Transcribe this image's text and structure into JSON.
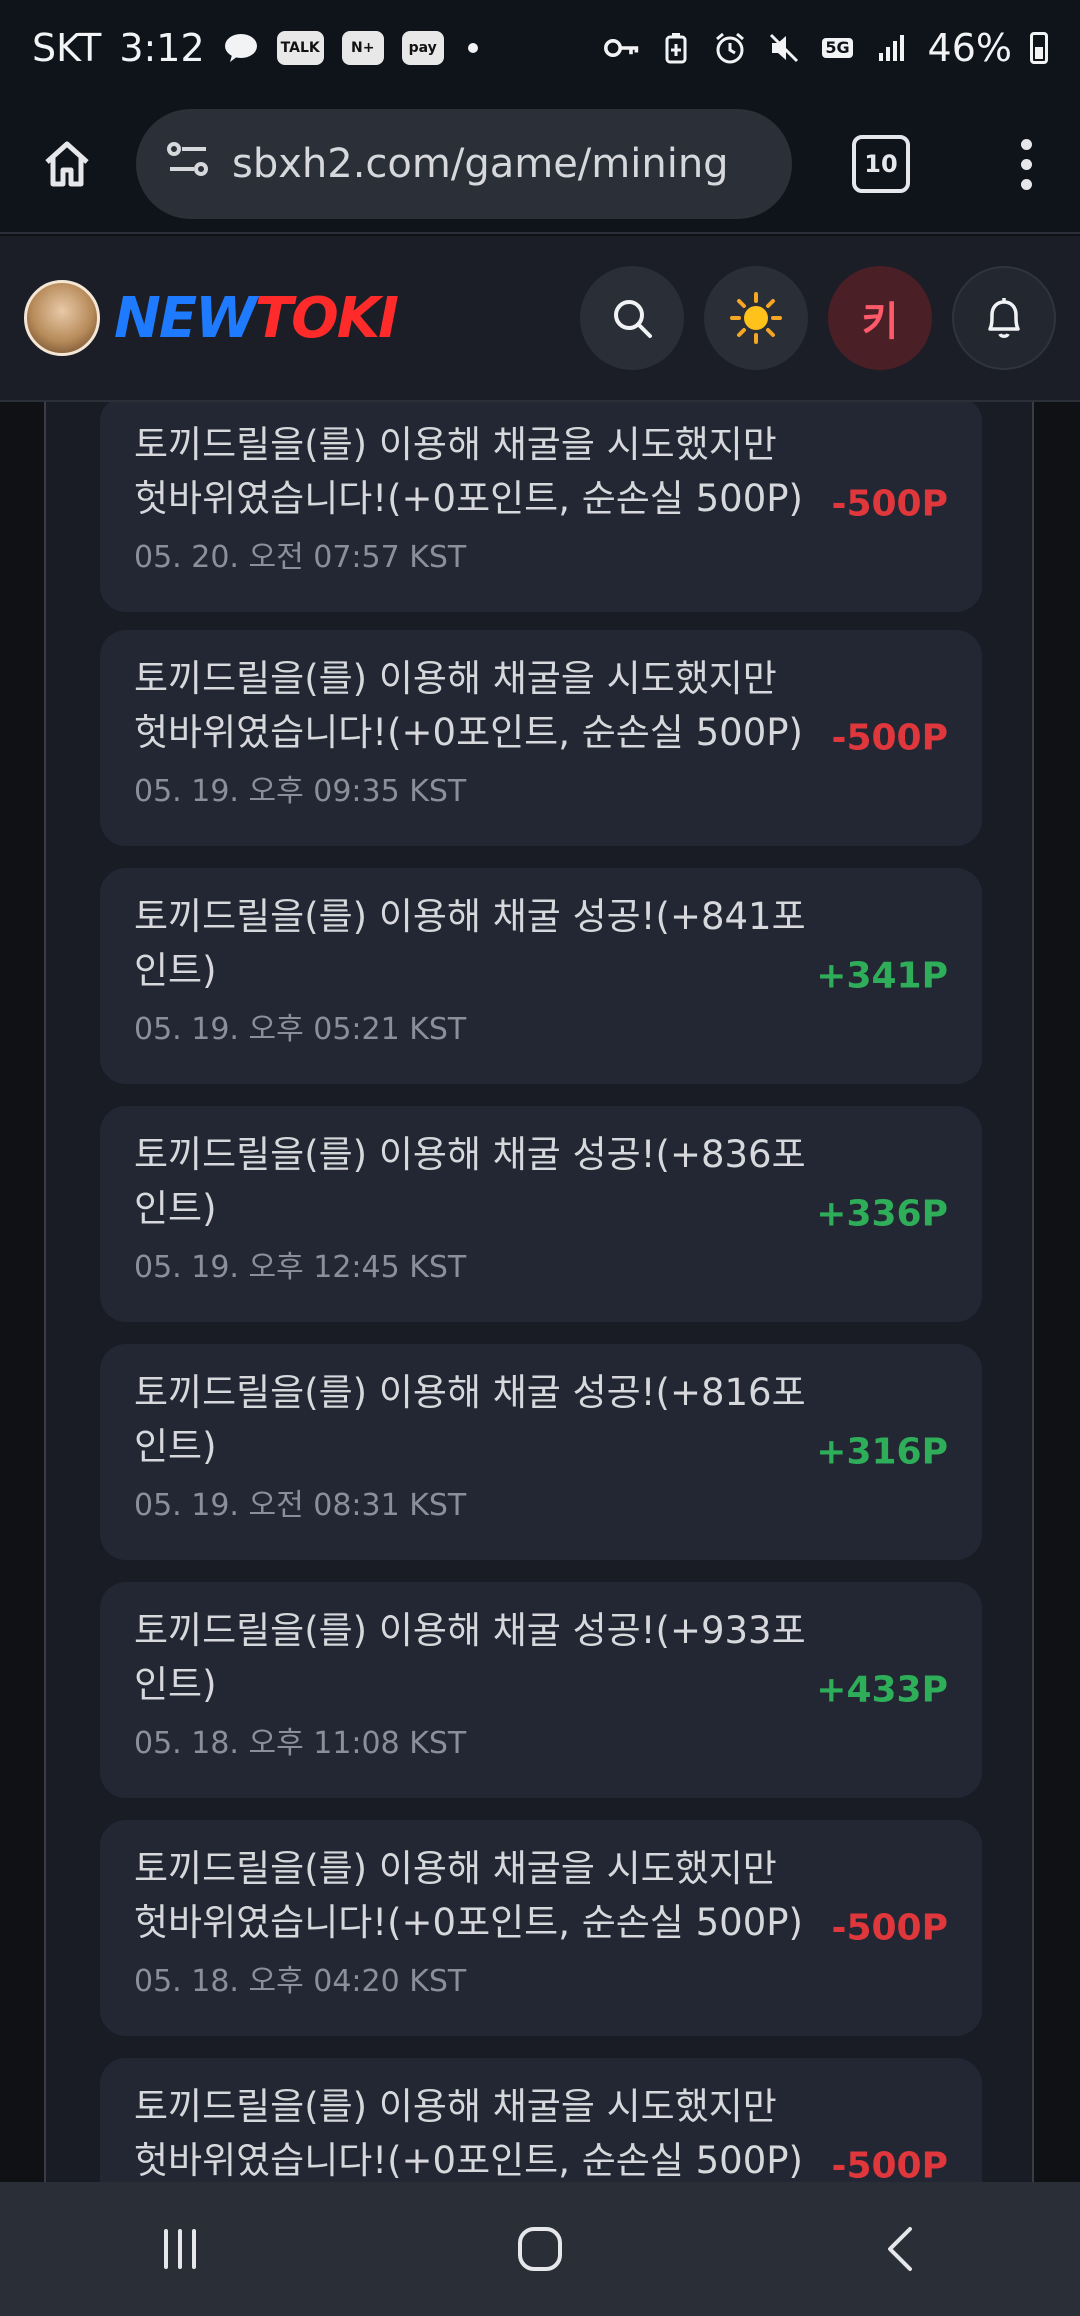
{
  "status_bar": {
    "carrier": "SKT",
    "time": "3:12",
    "badges": [
      "TALK",
      "N+",
      "pay"
    ],
    "network": "5G",
    "battery": "46%",
    "icons": [
      "message-icon",
      "key-icon",
      "battery-saver-icon",
      "alarm-icon",
      "mute-icon",
      "signal-icon",
      "battery-icon"
    ]
  },
  "browser": {
    "url": "sbxh2.com/game/mining",
    "tab_count": "10"
  },
  "site_header": {
    "logo_new": "NEW",
    "logo_toki": "TOKI",
    "user_initial": "키"
  },
  "mining_log": [
    {
      "message": "토끼드릴을(를) 이용해 채굴을 시도했지만 헛바위였습니다!(+0포인트, 순손실 500P)",
      "time": "05. 20. 오전 07:57 KST",
      "amount": "-500P",
      "type": "neg"
    },
    {
      "message": "토끼드릴을(를) 이용해 채굴을 시도했지만 헛바위였습니다!(+0포인트, 순손실 500P)",
      "time": "05. 19. 오후 09:35 KST",
      "amount": "-500P",
      "type": "neg"
    },
    {
      "message": "토끼드릴을(를) 이용해 채굴 성공!(+841포인트)",
      "time": "05. 19. 오후 05:21 KST",
      "amount": "+341P",
      "type": "pos"
    },
    {
      "message": "토끼드릴을(를) 이용해 채굴 성공!(+836포인트)",
      "time": "05. 19. 오후 12:45 KST",
      "amount": "+336P",
      "type": "pos"
    },
    {
      "message": "토끼드릴을(를) 이용해 채굴 성공!(+816포인트)",
      "time": "05. 19. 오전 08:31 KST",
      "amount": "+316P",
      "type": "pos"
    },
    {
      "message": "토끼드릴을(를) 이용해 채굴 성공!(+933포인트)",
      "time": "05. 18. 오후 11:08 KST",
      "amount": "+433P",
      "type": "pos"
    },
    {
      "message": "토끼드릴을(를) 이용해 채굴을 시도했지만 헛바위였습니다!(+0포인트, 순손실 500P)",
      "time": "05. 18. 오후 04:20 KST",
      "amount": "-500P",
      "type": "neg"
    },
    {
      "message": "토끼드릴을(를) 이용해 채굴을 시도했지만 헛바위였습니다!(+0포인트, 순손실 500P)",
      "time": "",
      "amount": "-500P",
      "type": "neg"
    }
  ],
  "colors": {
    "negative": "#e0373d",
    "positive": "#2fae5a",
    "logo_blue": "#1e7bff",
    "logo_red": "#ff2b2b"
  }
}
